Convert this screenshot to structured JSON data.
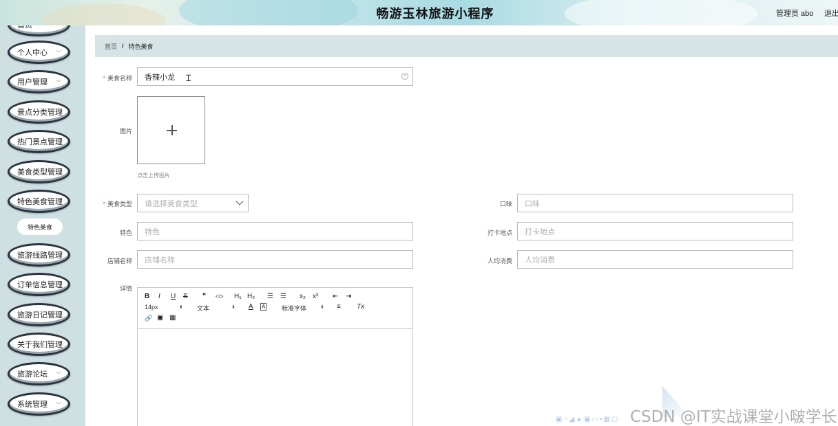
{
  "header": {
    "title": "畅游玉林旅游小程序",
    "user": "管理员 abo",
    "logout": "退出"
  },
  "sidebar": {
    "items": [
      {
        "label": "首页",
        "chevron": false
      },
      {
        "label": "个人中心",
        "chevron": true
      },
      {
        "label": "用户管理",
        "chevron": true
      },
      {
        "label": "景点分类管理",
        "chevron": false
      },
      {
        "label": "热门景点管理",
        "chevron": false
      },
      {
        "label": "美食类型管理",
        "chevron": false
      },
      {
        "label": "特色美食管理",
        "chevron": false
      },
      {
        "label": "旅游线路管理",
        "chevron": false
      },
      {
        "label": "订单信息管理",
        "chevron": false
      },
      {
        "label": "旅游日记管理",
        "chevron": false
      },
      {
        "label": "关于我们管理",
        "chevron": false
      },
      {
        "label": "旅游论坛",
        "chevron": true
      },
      {
        "label": "系统管理",
        "chevron": true
      }
    ],
    "submenu": {
      "label": "特色美食"
    }
  },
  "breadcrumb": {
    "home": "首页",
    "separator": "/",
    "current": "特色美食"
  },
  "form": {
    "name": {
      "label": "美食名称",
      "value": "香辣小龙",
      "required": true
    },
    "image": {
      "label": "图片",
      "hint": "点击上传图片"
    },
    "type": {
      "label": "美食类型",
      "placeholder": "请选择美食类型",
      "required": true
    },
    "taste": {
      "label": "口味",
      "placeholder": "口味"
    },
    "feature": {
      "label": "特色",
      "placeholder": "特色"
    },
    "checkin": {
      "label": "打卡地点",
      "placeholder": "打卡地点"
    },
    "shop": {
      "label": "店铺名称",
      "placeholder": "店铺名称"
    },
    "price": {
      "label": "人均消费",
      "placeholder": "人均消费"
    },
    "detail": {
      "label": "详情"
    }
  },
  "editor": {
    "bold": "B",
    "italic": "I",
    "underline": "U",
    "strike": "S",
    "quote": "❞",
    "code": "</>",
    "h1": "H₁",
    "h2": "H₂",
    "ordered_list": "☰",
    "bullet_list": "☰",
    "subscript": "x₂",
    "superscript": "x²",
    "outdent": "⇤",
    "indent": "⇥",
    "size": "14px",
    "paragraph": "文本",
    "font_color": "A",
    "bg_color": "A",
    "font": "标准字体",
    "align": "≡",
    "clear": "Tx",
    "link": "🔗",
    "image": "▣",
    "video": "▦"
  },
  "watermark": "CSDN @IT实战课堂小啵学长",
  "colors": {
    "sidebar_bg": "#cfe0e3",
    "breadcrumb_bg": "#d6e4e6",
    "required": "#e65c5c",
    "menu_border": "#2a3440"
  }
}
